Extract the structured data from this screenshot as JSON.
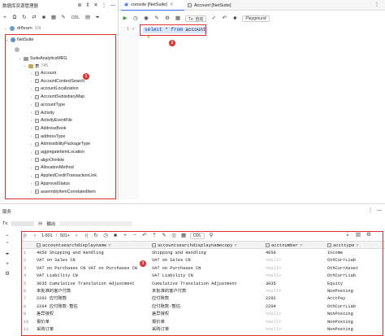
{
  "left_panel": {
    "title": "数据库资源管理器",
    "toolbar_icons": [
      "add-icon",
      "refresh-icon",
      "filter-icon",
      "properties-icon",
      "ddl-icon",
      "sql-console-icon",
      "collapse-icon",
      "settings-icon",
      "minimize-icon"
    ],
    "ddl_label": "DDL",
    "drflearn": {
      "name": "drflearn",
      "count": "1/9"
    },
    "netsuite": {
      "name": "NetSuite"
    },
    "schema": {
      "name": "SuiteAnalyticsMRG"
    },
    "tables_folder": {
      "name": "表",
      "count": "745"
    },
    "tables": [
      "Account",
      "AccountContextSearch",
      "accountLocalization",
      "AccountSubsidiaryMap",
      "accountType",
      "Activity",
      "ActivityEventFile",
      "AddressBook",
      "addressType",
      "AdmissibilityPackageType",
      "aggregateItemLocation",
      "alignOnHide",
      "AllocationMethod",
      "AppliedCreditTransactionLink",
      "ApprovalStatus",
      "assemblyItemCorrelatedItem"
    ]
  },
  "editor": {
    "tabs": [
      {
        "label": "console [NetSuite]",
        "active": true
      },
      {
        "label": "Account [NetSuite]",
        "active": false
      }
    ],
    "tx_label": "Tx: 自动",
    "playground_label": "Playground",
    "code": {
      "keyword1": "select",
      "rest": " * ",
      "keyword2": "from",
      "table": " account"
    }
  },
  "markers": [
    "1",
    "2",
    "3"
  ],
  "services": {
    "title": "服务",
    "tab_prefix": "Tx",
    "output_label": "输出",
    "pagination": "1-501",
    "total": "501+",
    "ddl_label": "DDL",
    "columns": [
      "accountsearchdisplayname",
      "accountsearchdisplaynamecopy",
      "acctnumber",
      "accttype"
    ],
    "rows": [
      [
        "1",
        "4050 Shipping and Handling",
        "Shipping and Handling",
        "4050",
        "Income"
      ],
      [
        "2",
        "VAT on Sales CN",
        "VAT on Sales CN",
        "<null>",
        "OthCurrLiab"
      ],
      [
        "3",
        "VAT on Purchases CN VAT on Purchases CN",
        "VAT on Purchases CN",
        "<null>",
        "OthCurrAsset"
      ],
      [
        "4",
        "VAT Liability CN",
        "VAT Liability CN",
        "<null>",
        "OthCurrLiab"
      ],
      [
        "5",
        "3035 Cumulative Translation Adjustment",
        "Cumulative Translation Adjustment",
        "3035",
        "Equity"
      ],
      [
        "6",
        "未批准的客户付款",
        "未批准的客户付款",
        "<null>",
        "NonPosting"
      ],
      [
        "7",
        "2202 应付账款",
        "应付账款",
        "2202",
        "AcctPay"
      ],
      [
        "8",
        "2204 应付账款-暂估",
        "应付账款-暂估",
        "2204",
        "OthCurrLiab"
      ],
      [
        "9",
        "差异授权",
        "差异授权",
        "<null>",
        "NonPosting"
      ],
      [
        "10",
        "报价单",
        "报价单",
        "<null>",
        "NonPosting"
      ],
      [
        "11",
        "采购订单",
        "采购订单",
        "<null>",
        "NonPosting"
      ]
    ]
  }
}
